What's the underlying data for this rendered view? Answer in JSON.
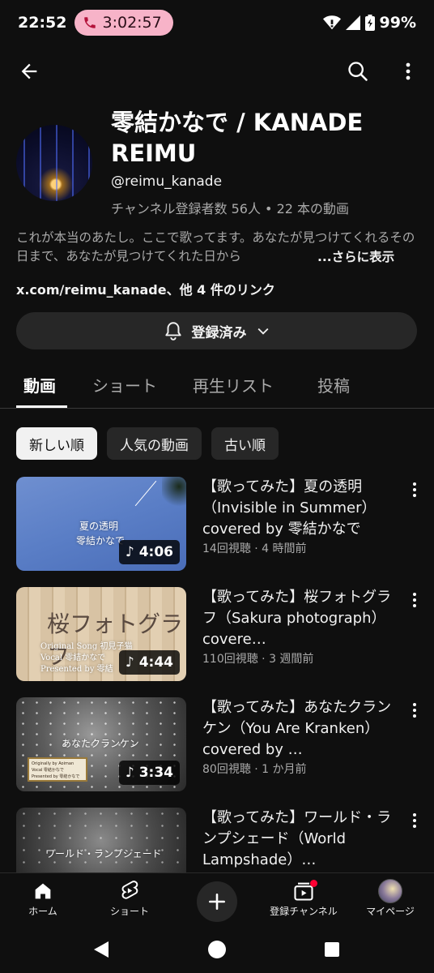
{
  "status_bar": {
    "time": "22:52",
    "call_timer": "3:02:57",
    "battery": "99%"
  },
  "channel": {
    "name": "零結かなで / KANADE REIMU",
    "handle": "@reimu_kanade",
    "stats": "チャンネル登録者数 56人 • 22 本の動画",
    "description": "これが本当のあたし。ここで歌ってます。あなたが見つけてくれるその日まで、あなたが見つけてくれた日から",
    "more_label": "...さらに表示",
    "links_text": "x.com/reimu_kanade、他 4 件のリンク",
    "subscribe_label": "登録済み"
  },
  "tabs": [
    "動画",
    "ショート",
    "再生リスト",
    "投稿"
  ],
  "chips": [
    "新しい順",
    "人気の動画",
    "古い順"
  ],
  "videos": [
    {
      "title": "【歌ってみた】夏の透明（Invisible in Summer） covered by 零結かなで",
      "meta": "14回視聴 · 4 時間前",
      "duration": "4:06",
      "thumb_text_1": "夏の透明",
      "thumb_text_2": "零結かなで"
    },
    {
      "title": "【歌ってみた】桜フォトグラフ（Sakura photograph） covere…",
      "meta": "110回視聴 · 3 週間前",
      "duration": "4:44",
      "thumb_text_1": "桜フォトグラフ",
      "thumb_text_2": "Original Song 初見子猫",
      "thumb_text_3": "Vocal 零結かなで",
      "thumb_text_4": "Presented by 零結"
    },
    {
      "title": "【歌ってみた】あなたクランケン（You Are Kranken） covered by …",
      "meta": "80回視聴 · 1 か月前",
      "duration": "3:34",
      "thumb_text_1": "あなたクランケン",
      "thumb_text_2": "Originally by Aoiman",
      "thumb_text_3": "Vocal 零結かなで",
      "thumb_text_4": "Presented by 零結かなで"
    },
    {
      "title": "【歌ってみた】ワールド・ランプシェード（World Lampshade）…",
      "meta": "",
      "duration": "",
      "thumb_text_1": "ワールド・ランプシェード"
    }
  ],
  "bottom_nav": {
    "home": "ホーム",
    "shorts": "ショート",
    "subscriptions": "登録チャンネル",
    "you": "マイページ"
  },
  "colors": {
    "background": "#0f0f0f",
    "surface": "#272727",
    "text_primary": "#f1f1f1",
    "text_secondary": "#aaaaaa",
    "call_pill": "#f7b3c8",
    "notification_dot": "#ff0033"
  }
}
